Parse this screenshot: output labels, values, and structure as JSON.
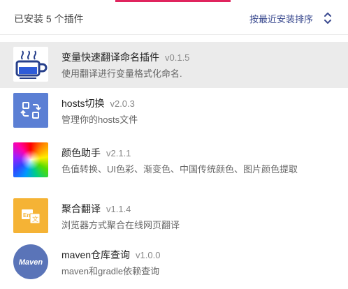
{
  "header": {
    "installed_count": "已安装 5 个插件",
    "sort_label": "按最近安装排序"
  },
  "colors": {
    "accent": "#e0245e",
    "sort_text": "#3a4a8f",
    "selected_bg": "#ebebeb"
  },
  "plugins": [
    {
      "name": "变量快速翻译命名插件",
      "version": "v0.1.5",
      "desc": "使用翻译进行变量格式化命名.",
      "icon": "coffee-cup-icon"
    },
    {
      "name": "hosts切换",
      "version": "v2.0.3",
      "desc": "管理你的hosts文件",
      "icon": "switch-arrows-icon"
    },
    {
      "name": "颜色助手",
      "version": "v2.1.1",
      "desc": "色值转换、UI色彩、渐变色、中国传统颜色、图片颜色提取",
      "icon": "color-wheel-icon"
    },
    {
      "name": "聚合翻译",
      "version": "v1.1.4",
      "desc": "浏览器方式聚合在线网页翻译",
      "icon": "translate-icon"
    },
    {
      "name": "maven仓库查询",
      "version": "v1.0.0",
      "desc": "maven和gradle依赖查询",
      "icon": "maven-logo-icon",
      "logo_text": "Maven"
    }
  ]
}
